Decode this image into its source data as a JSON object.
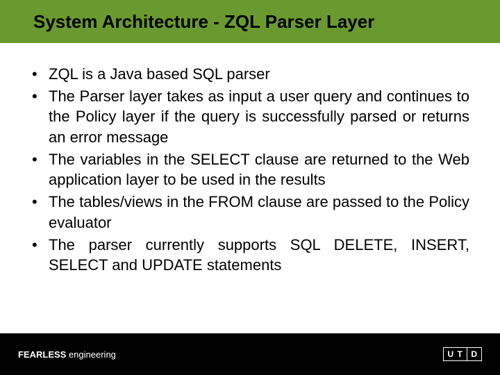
{
  "title": "System Architecture - ZQL Parser Layer",
  "bullets": [
    "ZQL is a Java based SQL parser",
    "The Parser layer takes as input a user query and continues to the Policy layer if the query is successfully parsed or returns an error message",
    "The variables in the SELECT clause are returned to the Web application layer to be used in the results",
    "The tables/views in the FROM clause are passed to the Policy evaluator",
    "The parser currently supports SQL DELETE, INSERT, SELECT and UPDATE statements"
  ],
  "footer": {
    "bold": "FEARLESS",
    "rest": " engineering"
  },
  "logo": {
    "left": "U T",
    "right": "D"
  }
}
